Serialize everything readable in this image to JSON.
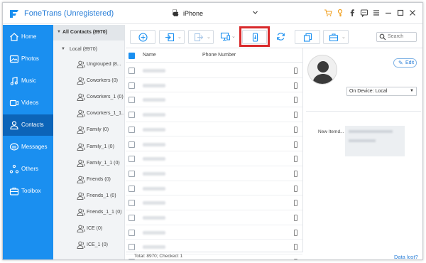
{
  "app": {
    "title": "FoneTrans (Unregistered)",
    "device": "iPhone"
  },
  "title_icons": [
    "cart-icon",
    "key-icon",
    "facebook-icon",
    "chat-icon",
    "menu-icon",
    "minimize-icon",
    "maximize-icon",
    "close-icon"
  ],
  "sidebar": {
    "items": [
      {
        "label": "Home",
        "icon": "home-icon"
      },
      {
        "label": "Photos",
        "icon": "photos-icon"
      },
      {
        "label": "Music",
        "icon": "music-icon"
      },
      {
        "label": "Videos",
        "icon": "videos-icon"
      },
      {
        "label": "Contacts",
        "icon": "contacts-icon",
        "active": true
      },
      {
        "label": "Messages",
        "icon": "messages-icon"
      },
      {
        "label": "Others",
        "icon": "others-icon"
      },
      {
        "label": "Toolbox",
        "icon": "toolbox-icon"
      }
    ]
  },
  "tree": {
    "all_contacts": "All Contacts  (8970)",
    "local": "Local  (8970)",
    "groups": [
      "Ungrouped  (8...",
      "Coworkers  (0)",
      "Coworkers_1  (0)",
      "Coworkers_1_1...",
      "Family  (0)",
      "Family_1  (0)",
      "Family_1_1  (0)",
      "Friends  (0)",
      "Friends_1  (0)",
      "Friends_1_1  (0)",
      "ICE  (0)",
      "ICE_1  (0)"
    ]
  },
  "toolbar": {
    "buttons": [
      "add-icon",
      "import-icon",
      "export-icon",
      "to-pc-icon",
      "to-device-icon",
      "refresh-icon",
      "duplicate-icon",
      "toolbox-icon"
    ],
    "search_placeholder": "Search"
  },
  "list": {
    "col_name": "Name",
    "col_phone": "Phone Number",
    "row_count": 14
  },
  "status": {
    "text": "Total: 8970; Checked: 1"
  },
  "detail": {
    "edit_label": "Edit",
    "on_device": "On Device: Local",
    "new_item_label": "New Itemd...",
    "data_lost": "Data lost?"
  },
  "colors": {
    "accent": "#1a8ff0",
    "sidebar_active": "#0c64b8",
    "highlight": "#d9292b",
    "link": "#2a7fd8"
  }
}
